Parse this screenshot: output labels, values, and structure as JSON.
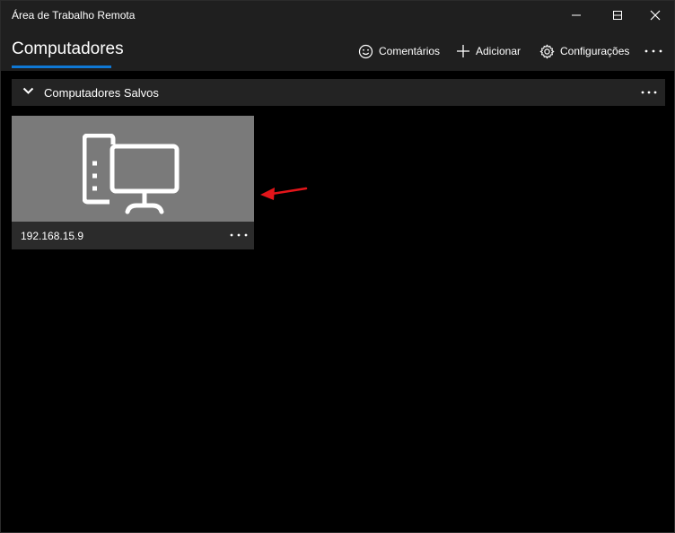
{
  "window": {
    "title": "Área de Trabalho Remota"
  },
  "commandbar": {
    "page_title": "Computadores",
    "feedback_label": "Comentários",
    "add_label": "Adicionar",
    "settings_label": "Configurações"
  },
  "group": {
    "title": "Computadores Salvos"
  },
  "tiles": [
    {
      "name": "192.168.15.9",
      "icon": "desktop-pc-icon"
    }
  ],
  "colors": {
    "accent": "#0f78d4",
    "annotation_arrow": "#e3151a",
    "tile_thumb": "#7a7a7a"
  }
}
